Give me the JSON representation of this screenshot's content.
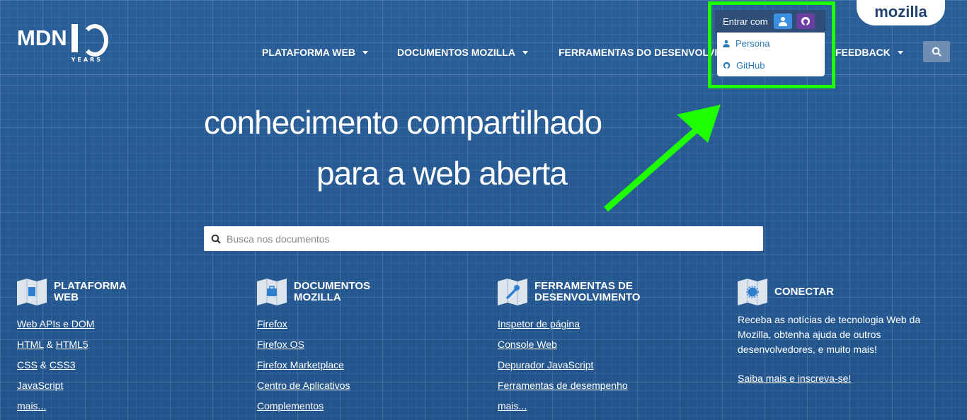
{
  "logo": {
    "text": "MDN",
    "years": "YEARS"
  },
  "mozilla_tab": "mozilla",
  "nav": {
    "items": [
      {
        "label": "PLATAFORMA WEB"
      },
      {
        "label": "DOCUMENTOS MOZILLA"
      },
      {
        "label": "FERRAMENTAS DO DESENVOLVI"
      },
      {
        "label": "FEEDBACK"
      }
    ]
  },
  "login": {
    "label": "Entrar com",
    "options": [
      {
        "label": "Persona",
        "icon": "user-icon"
      },
      {
        "label": "GitHub",
        "icon": "github-icon"
      }
    ]
  },
  "hero": {
    "line1": "conhecimento compartilhado",
    "line2": "para a web aberta"
  },
  "search": {
    "placeholder": "Busca nos documentos"
  },
  "columns": [
    {
      "title_line1": "PLATAFORMA",
      "title_line2": "WEB",
      "links": [
        {
          "parts": [
            "Web APIs e DOM"
          ]
        },
        {
          "parts": [
            "HTML",
            " & ",
            "HTML5"
          ]
        },
        {
          "parts": [
            "CSS",
            " & ",
            "CSS3"
          ]
        },
        {
          "parts": [
            "JavaScript"
          ]
        },
        {
          "parts": [
            "mais..."
          ]
        }
      ]
    },
    {
      "title_line1": "DOCUMENTOS",
      "title_line2": "MOZILLA",
      "links": [
        {
          "parts": [
            "Firefox"
          ]
        },
        {
          "parts": [
            "Firefox OS"
          ]
        },
        {
          "parts": [
            "Firefox Marketplace"
          ]
        },
        {
          "parts": [
            "Centro de Aplicativos"
          ]
        },
        {
          "parts": [
            "Complementos"
          ]
        }
      ]
    },
    {
      "title_line1": "FERRAMENTAS DE",
      "title_line2": "DESENVOLVIMENTO",
      "links": [
        {
          "parts": [
            "Inspetor de página"
          ]
        },
        {
          "parts": [
            "Console Web"
          ]
        },
        {
          "parts": [
            "Depurador JavaScript"
          ]
        },
        {
          "parts": [
            "Ferramentas de desempenho"
          ]
        },
        {
          "parts": [
            "mais..."
          ]
        }
      ]
    },
    {
      "title_line1": "CONECTAR",
      "text": "Receba as notícias de tecnologia Web da Mozilla, obtenha ajuda de outros desenvolvedores, e muito mais!",
      "link": "Saiba mais e inscreva-se!"
    }
  ],
  "colors": {
    "highlight": "#1eff00",
    "background": "#24568f",
    "link": "#2a7ab8"
  }
}
